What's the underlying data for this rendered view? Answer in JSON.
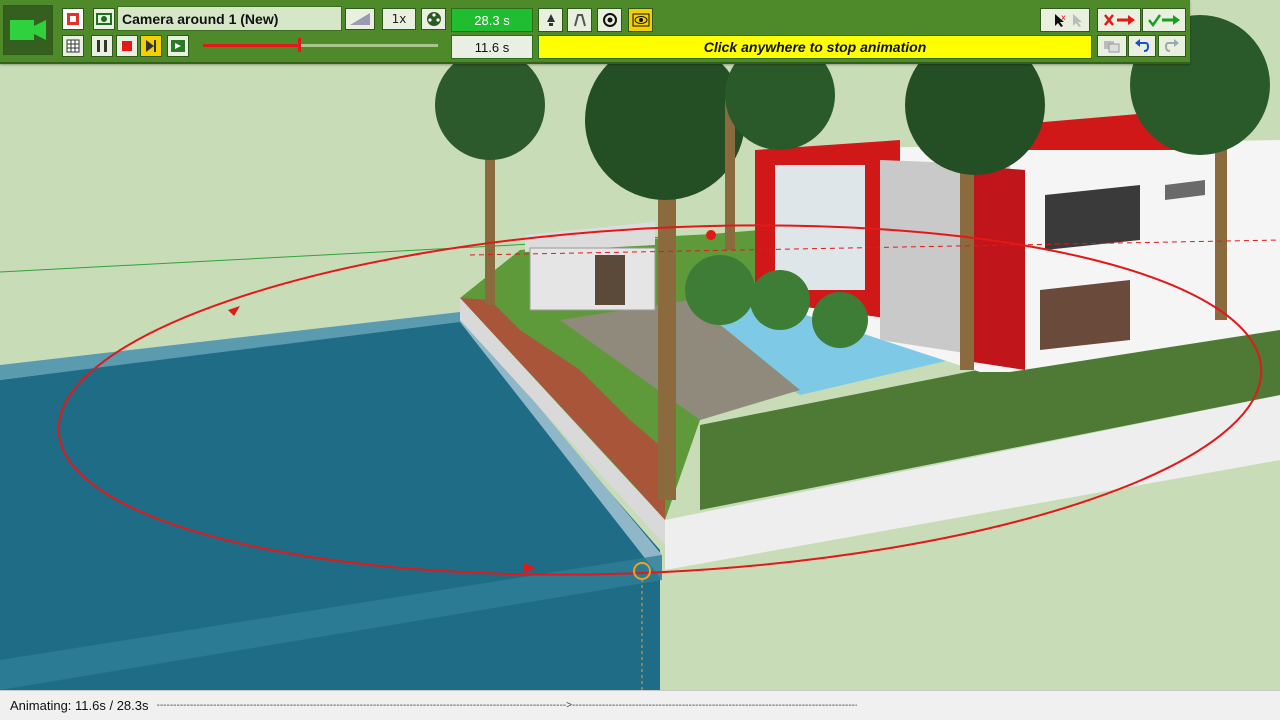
{
  "toolbar": {
    "animation_name": "Camera around 1 (New)",
    "speed": "1x",
    "total_duration": "28.3 s",
    "current_time": "11.6 s",
    "message": "Click anywhere to stop animation",
    "progress_fraction": 0.41,
    "icons": {
      "camera": "video-camera-icon",
      "sketchup": "sketchup-logo-icon",
      "scene": "scene-icon",
      "grid": "spreadsheet-icon",
      "pause": "pause-icon",
      "stop": "stop-icon",
      "next": "step-forward-icon",
      "export": "film-export-icon"
    }
  },
  "status": {
    "text": "Animating: 11.6s / 28.3s",
    "dash_line": "--------------------------------------------------------------------------------------------------------------------------->--------------------------------------------------------------------------------------------------------------------"
  },
  "colors": {
    "toolbar_bg": "#4f8a2a",
    "path_red": "#e31818",
    "message_bg": "#ffff00",
    "time_green": "#1fbd2f",
    "water": "#1f6c86",
    "grass": "#c9dcb8"
  }
}
